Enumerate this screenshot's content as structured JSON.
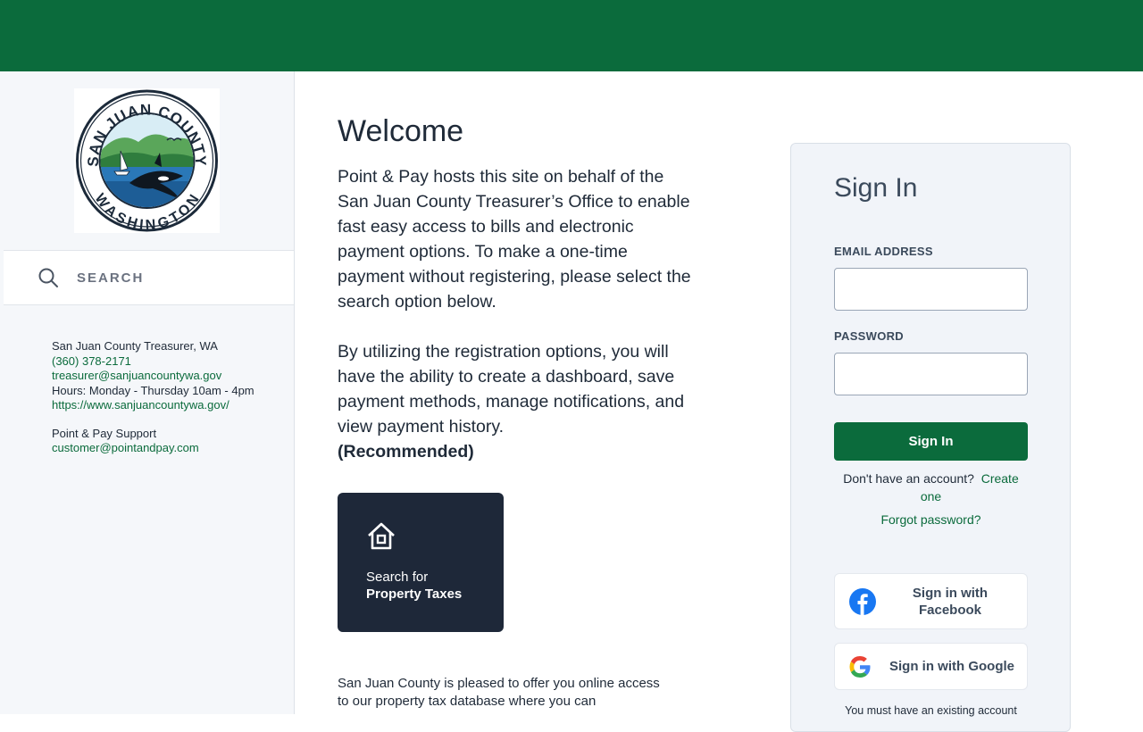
{
  "sidebar": {
    "logo_alt": "San Juan County Washington seal",
    "logo_top_text": "SAN JUAN COUNTY",
    "logo_bottom_text": "WASHINGTON",
    "search_placeholder": "SEARCH",
    "contact": {
      "office": "San Juan County Treasurer, WA",
      "phone": "(360) 378-2171",
      "email": "treasurer@sanjuancountywa.gov",
      "hours": "Hours: Monday - Thursday 10am - 4pm",
      "website": "https://www.sanjuancountywa.gov/",
      "support_title": "Point & Pay Support",
      "support_email": "customer@pointandpay.com"
    }
  },
  "main": {
    "title": "Welcome",
    "paragraph1": "Point & Pay hosts this site on behalf of the San Juan County Treasurer’s Office to enable fast easy access to bills and electronic payment options.  To make a one-time payment without registering, please select the search option below.",
    "paragraph2": "By utilizing the registration options, you will have the ability to create a dashboard, save payment methods, manage notifications, and view payment history.",
    "recommended": "(Recommended)",
    "tile": {
      "line1": "Search for",
      "line2": "Property Taxes"
    },
    "intro": " San Juan County is pleased to offer you online access to our property tax database where you can"
  },
  "signin": {
    "title": "Sign In",
    "email_label": "EMAIL ADDRESS",
    "password_label": "PASSWORD",
    "button": "Sign In",
    "no_account": "Don't have an account?",
    "create": "Create one",
    "forgot": "Forgot password?",
    "facebook": "Sign in with Facebook",
    "google": "Sign in with Google",
    "must_have": "You must have an existing account"
  },
  "colors": {
    "brand_green": "#0b6b3c",
    "tile_navy": "#1e2839",
    "sidebar_bg": "#f5f7fa"
  }
}
